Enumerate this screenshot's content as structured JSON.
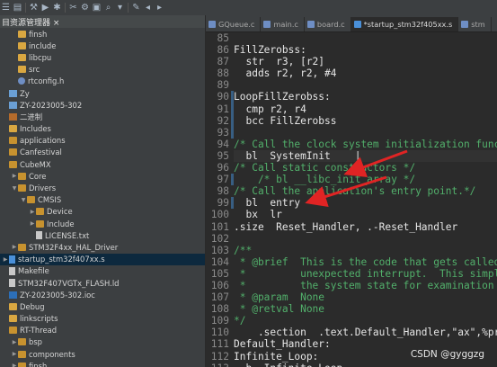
{
  "panel": {
    "title": "目资源管理器 ×",
    "tree": [
      {
        "label": "finsh",
        "icon": "folder",
        "indent": 1,
        "arrow": ""
      },
      {
        "label": "include",
        "icon": "folder",
        "indent": 1,
        "arrow": ""
      },
      {
        "label": "libcpu",
        "icon": "folder",
        "indent": 1,
        "arrow": ""
      },
      {
        "label": "src",
        "icon": "folder",
        "indent": 1,
        "arrow": ""
      },
      {
        "label": "rtconfig.h",
        "icon": "cfile",
        "indent": 1,
        "arrow": ""
      },
      {
        "label": "Zy",
        "icon": "proj",
        "indent": 0,
        "arrow": ""
      },
      {
        "label": "ZY-2023005-302",
        "icon": "proj",
        "indent": 0,
        "arrow": ""
      },
      {
        "label": "二进制",
        "icon": "bin",
        "indent": 0,
        "arrow": ""
      },
      {
        "label": "Includes",
        "icon": "folder",
        "indent": 0,
        "arrow": ""
      },
      {
        "label": "applications",
        "icon": "cfolder",
        "indent": 0,
        "arrow": ""
      },
      {
        "label": "Canfestival",
        "icon": "cfolder",
        "indent": 0,
        "arrow": ""
      },
      {
        "label": "CubeMX",
        "icon": "cfolder",
        "indent": 0,
        "arrow": ""
      },
      {
        "label": "Core",
        "icon": "cfolder",
        "indent": 1,
        "arrow": ">"
      },
      {
        "label": "Drivers",
        "icon": "cfolder",
        "indent": 1,
        "arrow": "v"
      },
      {
        "label": "CMSIS",
        "icon": "cfolder",
        "indent": 2,
        "arrow": "v"
      },
      {
        "label": "Device",
        "icon": "cfolder",
        "indent": 3,
        "arrow": ">"
      },
      {
        "label": "Include",
        "icon": "cfolder",
        "indent": 3,
        "arrow": ">"
      },
      {
        "label": "LICENSE.txt",
        "icon": "file",
        "indent": 3,
        "arrow": ""
      },
      {
        "label": "STM32F4xx_HAL_Driver",
        "icon": "cfolder",
        "indent": 1,
        "arrow": ">"
      },
      {
        "label": "startup_stm32f407xx.s",
        "icon": "sfile",
        "indent": 0,
        "arrow": ">",
        "selected": true
      },
      {
        "label": "Makefile",
        "icon": "file",
        "indent": 0,
        "arrow": ""
      },
      {
        "label": "STM32F407VGTx_FLASH.ld",
        "icon": "file",
        "indent": 0,
        "arrow": ""
      },
      {
        "label": "ZY-2023005-302.ioc",
        "icon": "ioc",
        "indent": 0,
        "arrow": ""
      },
      {
        "label": "Debug",
        "icon": "folder",
        "indent": 0,
        "arrow": ""
      },
      {
        "label": "linkscripts",
        "icon": "folder",
        "indent": 0,
        "arrow": ""
      },
      {
        "label": "RT-Thread",
        "icon": "cfolder",
        "indent": 0,
        "arrow": ""
      },
      {
        "label": "bsp",
        "icon": "cfolder",
        "indent": 1,
        "arrow": ">"
      },
      {
        "label": "components",
        "icon": "cfolder",
        "indent": 1,
        "arrow": ">"
      },
      {
        "label": "finsh",
        "icon": "cfolder",
        "indent": 1,
        "arrow": ">"
      }
    ]
  },
  "editor": {
    "tabs": [
      {
        "label": "GQueue.c",
        "active": false
      },
      {
        "label": "main.c",
        "active": false
      },
      {
        "label": "board.c",
        "active": false
      },
      {
        "label": "*startup_stm32f405xx.s",
        "active": true
      },
      {
        "label": "stm",
        "active": false
      }
    ],
    "lines": [
      {
        "n": "85",
        "text": "",
        "type": "code",
        "mod": false
      },
      {
        "n": "86",
        "text": "FillZerobss:",
        "type": "code",
        "mod": false
      },
      {
        "n": "87",
        "text": "  str  r3, [r2]",
        "type": "code",
        "mod": false
      },
      {
        "n": "88",
        "text": "  adds r2, r2, #4",
        "type": "code",
        "mod": false
      },
      {
        "n": "89",
        "text": "",
        "type": "code",
        "mod": false
      },
      {
        "n": "90",
        "text": "LoopFillZerobss:",
        "type": "code",
        "mod": true
      },
      {
        "n": "91",
        "text": "  cmp r2, r4",
        "type": "code",
        "mod": true
      },
      {
        "n": "92",
        "text": "  bcc FillZerobss",
        "type": "code",
        "mod": true
      },
      {
        "n": "93",
        "text": "",
        "type": "code",
        "mod": true
      },
      {
        "n": "94",
        "text": "/* Call the clock system initialization function.*/",
        "type": "comment",
        "mod": false
      },
      {
        "n": "95",
        "text": "  bl  SystemInit    |",
        "type": "code",
        "mod": false,
        "cur": true
      },
      {
        "n": "96",
        "text": "/* Call static constructors */",
        "type": "comment",
        "mod": false
      },
      {
        "n": "97",
        "text": "    /* bl __libc_init_array */",
        "type": "comment",
        "mod": true
      },
      {
        "n": "98",
        "text": "/* Call the application's entry point.*/",
        "type": "comment",
        "mod": false
      },
      {
        "n": "99",
        "text": "  bl  entry",
        "type": "code",
        "mod": true
      },
      {
        "n": "100",
        "text": "  bx  lr",
        "type": "code",
        "mod": false
      },
      {
        "n": "101",
        "text": ".size  Reset_Handler, .-Reset_Handler",
        "type": "code",
        "mod": false
      },
      {
        "n": "102",
        "text": "",
        "type": "code",
        "mod": false
      },
      {
        "n": "103",
        "text": "/**",
        "type": "comment",
        "mod": false
      },
      {
        "n": "104",
        "text": " * @brief  This is the code that gets called when the processor receives an",
        "type": "comment",
        "mod": false
      },
      {
        "n": "105",
        "text": " *         unexpected interrupt.  This simply enters an infinite loop, preserving",
        "type": "comment",
        "mod": false
      },
      {
        "n": "106",
        "text": " *         the system state for examination by a debugger.",
        "type": "comment",
        "mod": false
      },
      {
        "n": "107",
        "text": " * @param  None",
        "type": "comment",
        "mod": false
      },
      {
        "n": "108",
        "text": " * @retval None",
        "type": "comment",
        "mod": false
      },
      {
        "n": "109",
        "text": "*/",
        "type": "comment",
        "mod": false
      },
      {
        "n": "110",
        "text": "    .section  .text.Default_Handler,\"ax\",%progbits",
        "type": "code",
        "mod": false
      },
      {
        "n": "111",
        "text": "Default_Handler:",
        "type": "code",
        "mod": false
      },
      {
        "n": "112",
        "text": "Infinite_Loop:",
        "type": "code",
        "mod": false
      },
      {
        "n": "113",
        "text": "  b  Infinite_Loop",
        "type": "code",
        "mod": false
      }
    ]
  },
  "watermark": "CSDN @gyggzg",
  "colors": {
    "annotation_arrow": "#e02424",
    "comment": "#52b06b",
    "selection": "#0d293e"
  }
}
